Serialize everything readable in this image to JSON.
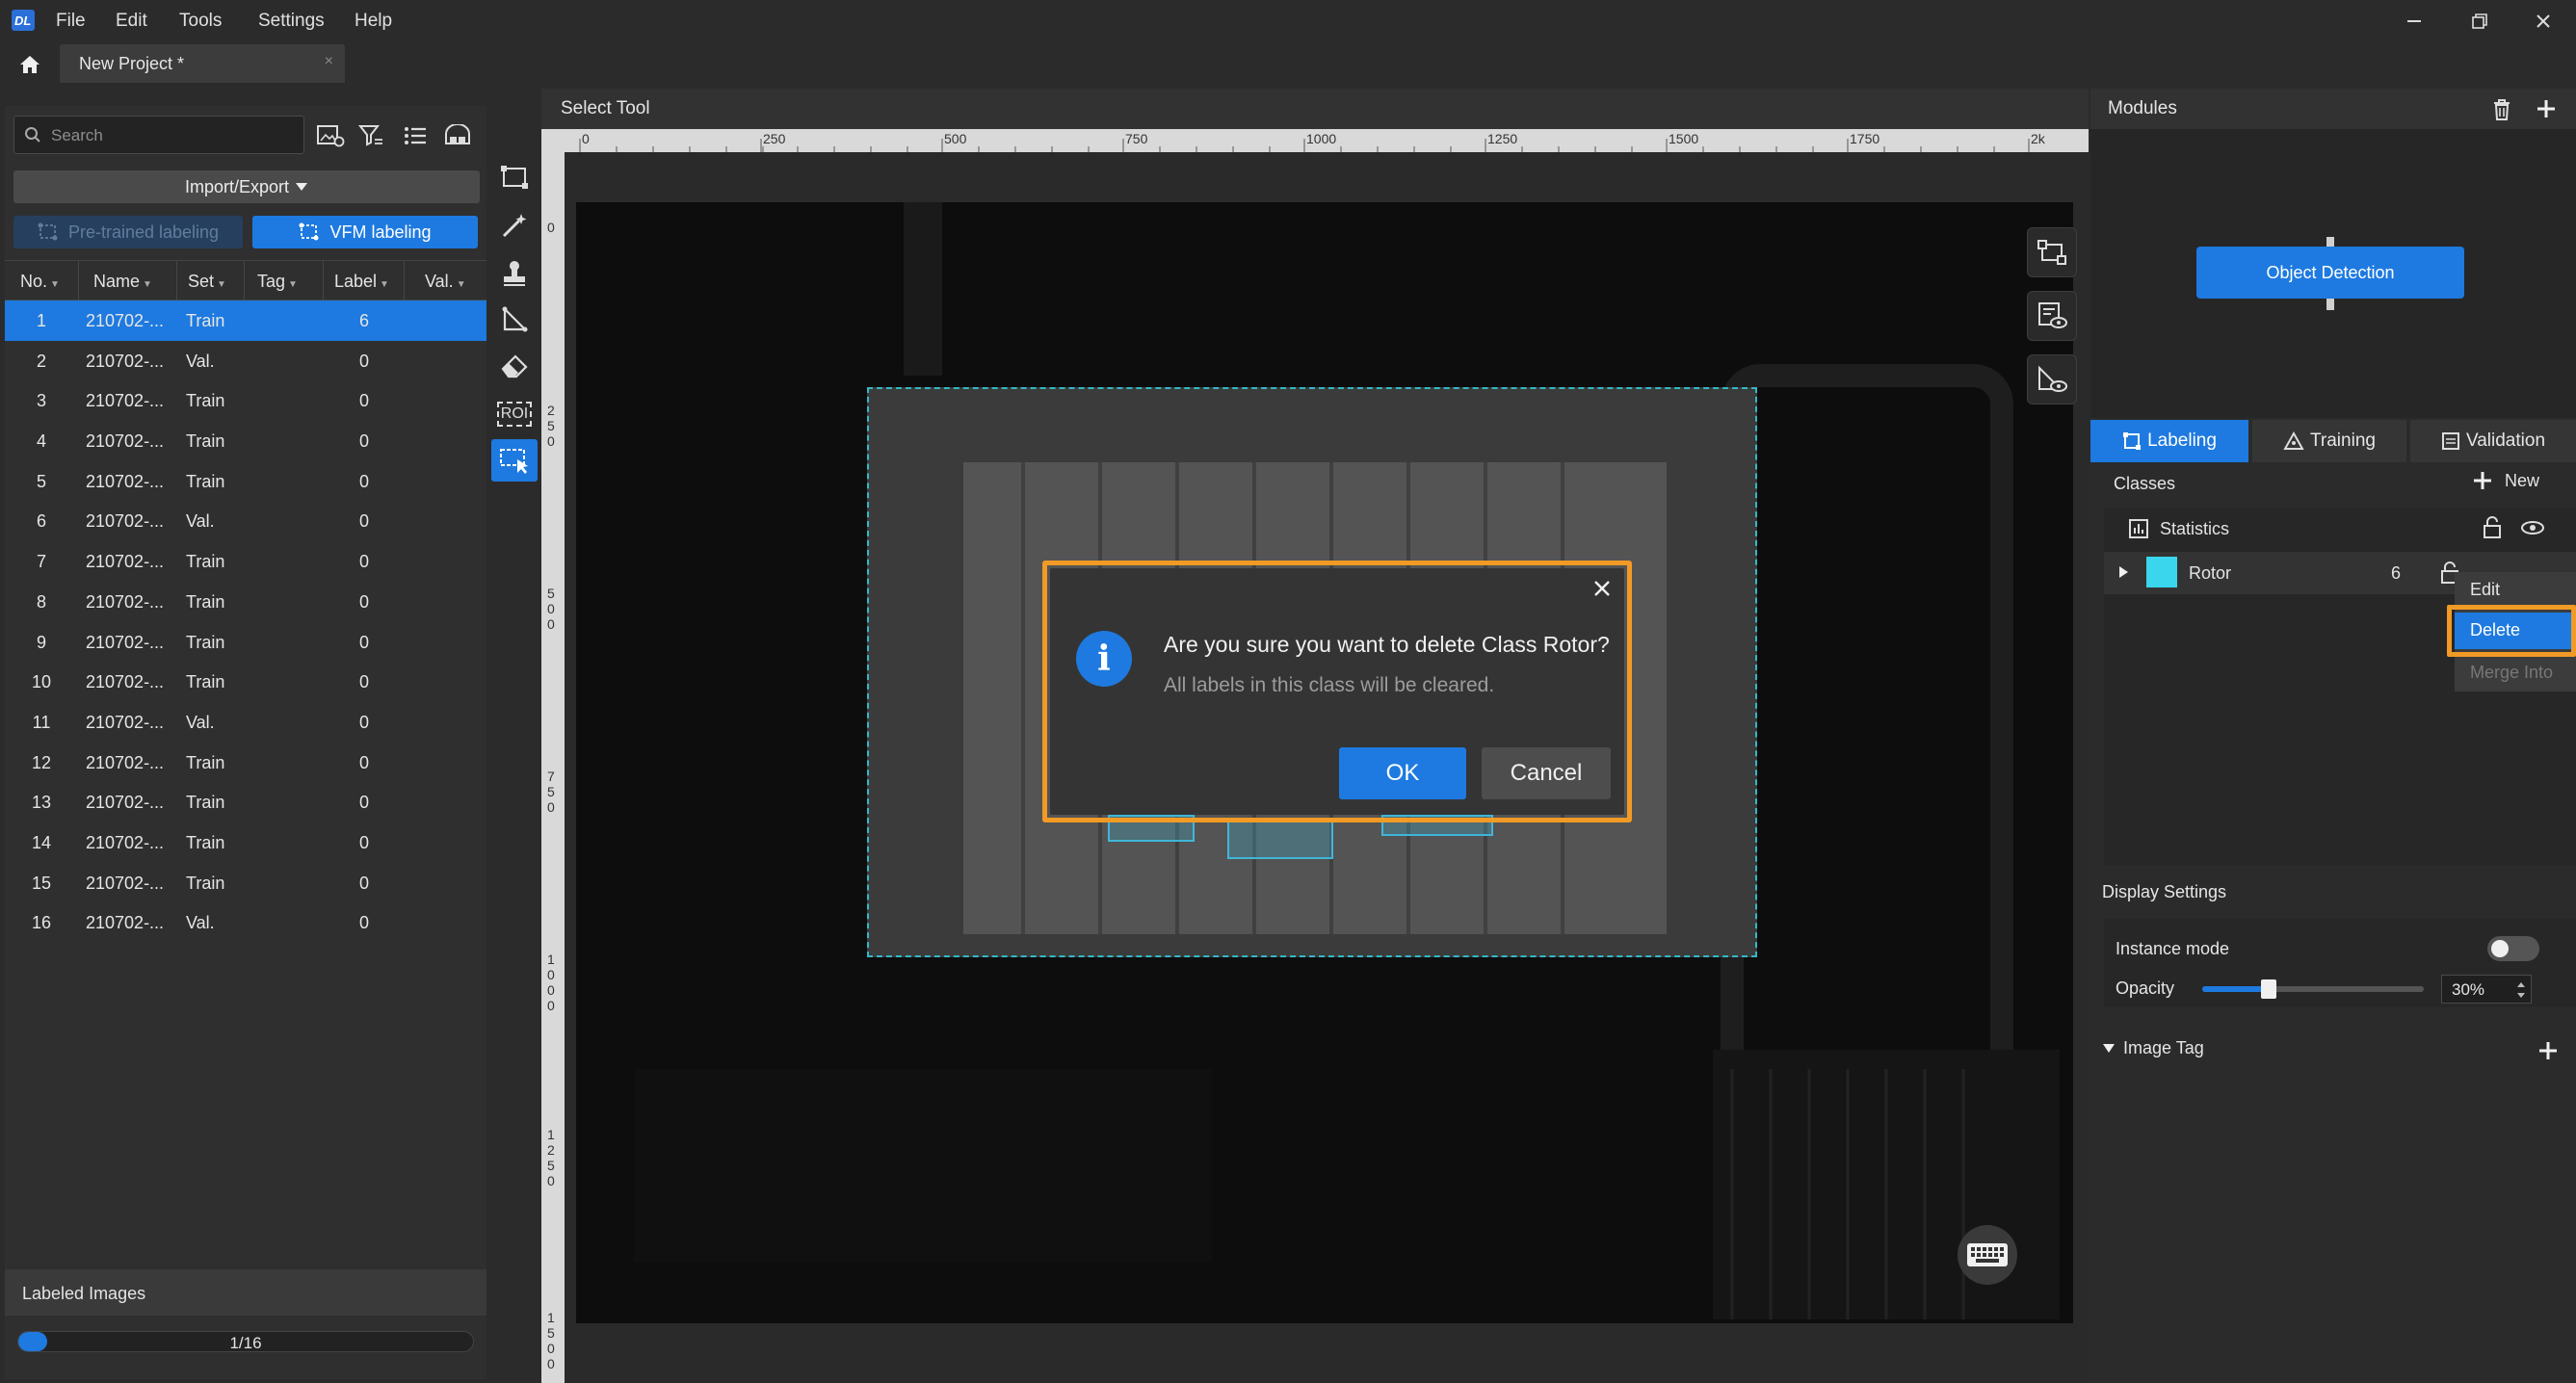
{
  "app": {
    "menu": [
      "File",
      "Edit",
      "Tools",
      "Settings",
      "Help"
    ],
    "project_tab": "New Project *",
    "tab_close": "×"
  },
  "left": {
    "search_placeholder": "Search",
    "import_export": "Import/Export",
    "pretrained": "Pre-trained labeling",
    "vfm": "VFM labeling",
    "columns": [
      "No.",
      "Name",
      "Set",
      "Tag",
      "Label",
      "Val."
    ],
    "rows": [
      {
        "no": "1",
        "name": "210702-...",
        "set": "Train",
        "label": "6"
      },
      {
        "no": "2",
        "name": "210702-...",
        "set": "Val.",
        "label": "0"
      },
      {
        "no": "3",
        "name": "210702-...",
        "set": "Train",
        "label": "0"
      },
      {
        "no": "4",
        "name": "210702-...",
        "set": "Train",
        "label": "0"
      },
      {
        "no": "5",
        "name": "210702-...",
        "set": "Train",
        "label": "0"
      },
      {
        "no": "6",
        "name": "210702-...",
        "set": "Val.",
        "label": "0"
      },
      {
        "no": "7",
        "name": "210702-...",
        "set": "Train",
        "label": "0"
      },
      {
        "no": "8",
        "name": "210702-...",
        "set": "Train",
        "label": "0"
      },
      {
        "no": "9",
        "name": "210702-...",
        "set": "Train",
        "label": "0"
      },
      {
        "no": "10",
        "name": "210702-...",
        "set": "Train",
        "label": "0"
      },
      {
        "no": "11",
        "name": "210702-...",
        "set": "Val.",
        "label": "0"
      },
      {
        "no": "12",
        "name": "210702-...",
        "set": "Train",
        "label": "0"
      },
      {
        "no": "13",
        "name": "210702-...",
        "set": "Train",
        "label": "0"
      },
      {
        "no": "14",
        "name": "210702-...",
        "set": "Train",
        "label": "0"
      },
      {
        "no": "15",
        "name": "210702-...",
        "set": "Train",
        "label": "0"
      },
      {
        "no": "16",
        "name": "210702-...",
        "set": "Val.",
        "label": "0"
      }
    ],
    "labeled_images_title": "Labeled Images",
    "labeled_progress_text": "1/16",
    "labeled_fraction": 0.0625
  },
  "tools": [
    "rect-tool",
    "magic-wand-tool",
    "stamp-tool",
    "polygon-tool",
    "eraser-tool",
    "roi-tool",
    "select-tool"
  ],
  "tools_roi_label": "ROI",
  "canvas": {
    "title": "Select Tool",
    "ruler_top": [
      "0",
      "250",
      "500",
      "750",
      "1000",
      "1250",
      "1500",
      "1750",
      "2k"
    ],
    "ruler_left": [
      "0",
      "250",
      "500",
      "750",
      "1000",
      "1250",
      "1500"
    ]
  },
  "dialog": {
    "message": "Are you sure you want to delete Class Rotor?",
    "sub": "All labels in this class will be cleared.",
    "ok": "OK",
    "cancel": "Cancel",
    "close": "×",
    "info_glyph": "i"
  },
  "right": {
    "modules_title": "Modules",
    "module_node": "Object Detection",
    "tabs": [
      "Labeling",
      "Training",
      "Validation"
    ],
    "classes_title": "Classes",
    "new_label": "New",
    "statistics": "Statistics",
    "class_name": "Rotor",
    "class_count": "6",
    "class_color": "#3ad6ee",
    "context_menu": [
      "Edit",
      "Delete",
      "Merge Into"
    ],
    "display_settings": "Display Settings",
    "instance_mode": "Instance mode",
    "instance_mode_on": false,
    "opacity_label": "Opacity",
    "opacity_value": "30%",
    "opacity_fraction": 0.3,
    "image_tag": "Image Tag"
  },
  "colors": {
    "accent": "#1e7ae0",
    "highlight": "#f29a26",
    "label_box": "#3fb6d9"
  }
}
